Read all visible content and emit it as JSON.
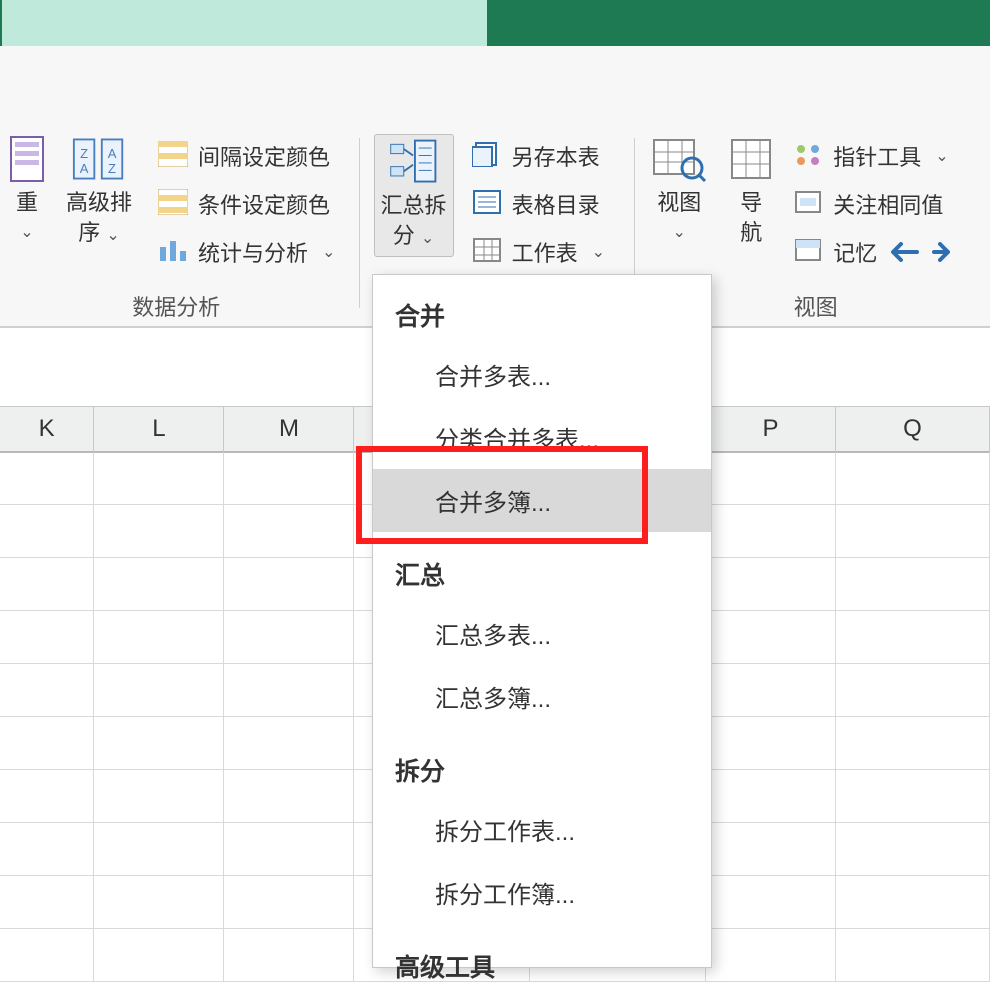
{
  "colors": {
    "accent": "#1e7a53",
    "accent_light": "#bfeadb",
    "ribbon_bg": "#f7f7f7",
    "highlight": "#ff1e1e"
  },
  "ribbon": {
    "groups": {
      "data_analysis": {
        "label": "数据分析",
        "dedup_label_1": "重",
        "advanced_sort_label_1": "高级排",
        "advanced_sort_label_2": "序",
        "items": {
          "interval_color": "间隔设定颜色",
          "cond_color": "条件设定颜色",
          "stats": "统计与分析"
        }
      },
      "summary": {
        "split_btn_1": "汇总拆",
        "split_btn_2": "分",
        "items": {
          "save_copy": "另存本表",
          "sheet_toc": "表格目录",
          "worksheet": "工作表"
        }
      },
      "view": {
        "label": "视图",
        "view_btn": "视图",
        "nav_btn_1": "导",
        "nav_btn_2": "航",
        "items": {
          "pointer_tools": "指针工具",
          "focus_same": "关注相同值",
          "memory": "记忆"
        }
      }
    }
  },
  "menu": {
    "sections": [
      {
        "header": "合并",
        "items": [
          "合并多表...",
          "分类合并多表...",
          "合并多簿..."
        ]
      },
      {
        "header": "汇总",
        "items": [
          "汇总多表...",
          "汇总多簿..."
        ]
      },
      {
        "header": "拆分",
        "items": [
          "拆分工作表...",
          "拆分工作簿..."
        ]
      },
      {
        "header": "高级工具",
        "items": []
      }
    ],
    "highlighted_index": {
      "section": 0,
      "item": 2
    }
  },
  "columns": [
    "K",
    "L",
    "M",
    "",
    "",
    "P",
    "Q"
  ]
}
